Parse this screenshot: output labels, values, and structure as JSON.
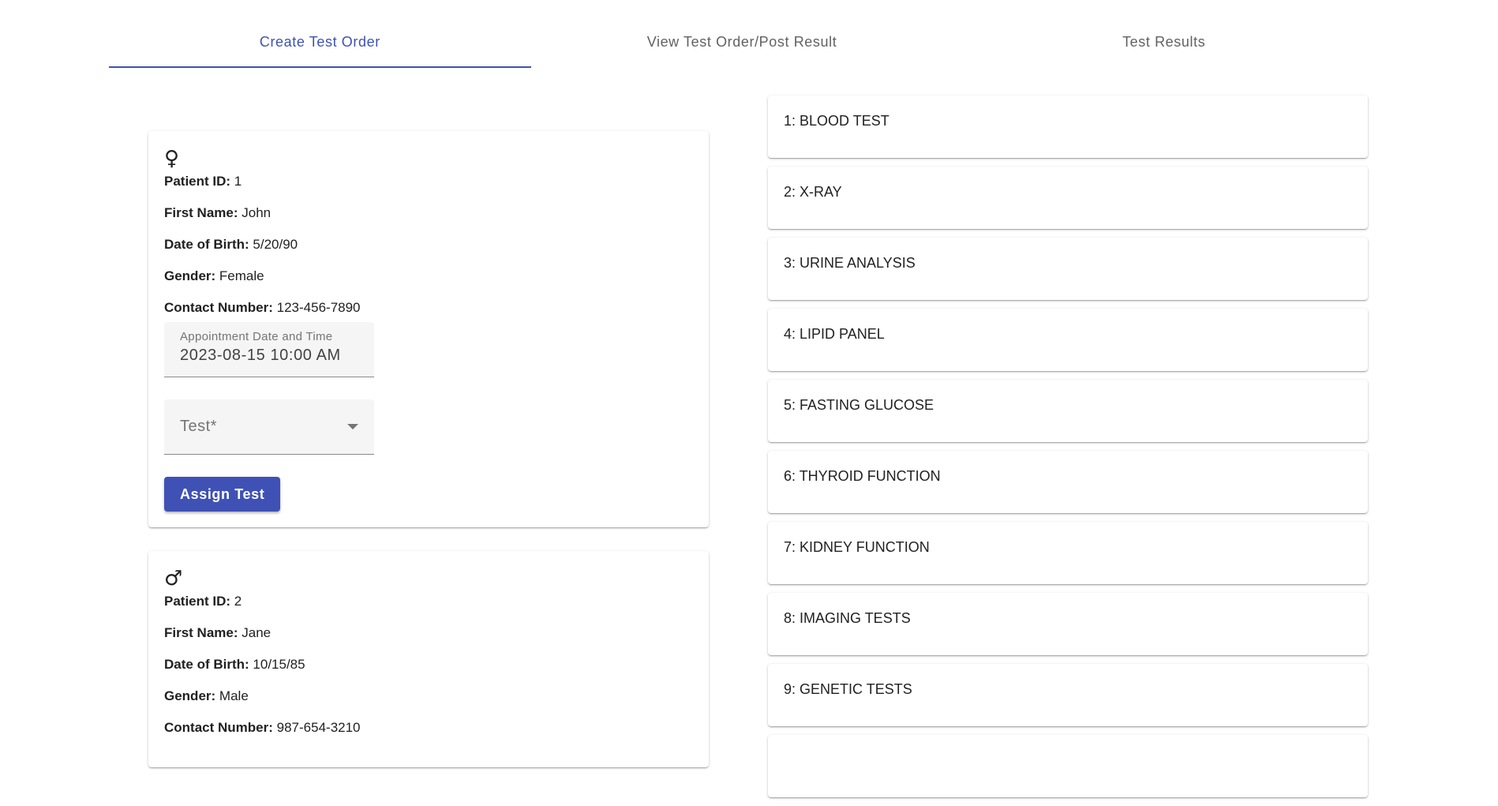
{
  "tabs": [
    {
      "label": "Create Test Order",
      "active": true
    },
    {
      "label": "View Test Order/Post Result",
      "active": false
    },
    {
      "label": "Test Results",
      "active": false
    }
  ],
  "colors": {
    "primary": "#3f51b5"
  },
  "patients": [
    {
      "gender_icon": "female-icon",
      "gender_symbol": "♀",
      "patient_id_label": "Patient ID:",
      "patient_id": "1",
      "first_name_label": "First Name:",
      "first_name": "John",
      "dob_label": "Date of Birth:",
      "dob": "5/20/90",
      "gender_label": "Gender:",
      "gender": "Female",
      "contact_label": "Contact Number:",
      "contact": "123-456-7890",
      "appointment_label": "Appointment Date and Time",
      "appointment_value": "2023-08-15 10:00  AM",
      "test_placeholder": "Test*",
      "assign_label": "Assign Test"
    },
    {
      "gender_icon": "male-icon",
      "gender_symbol": "♂",
      "patient_id_label": "Patient ID:",
      "patient_id": "2",
      "first_name_label": "First Name:",
      "first_name": "Jane",
      "dob_label": "Date of Birth:",
      "dob": "10/15/85",
      "gender_label": "Gender:",
      "gender": "Male",
      "contact_label": "Contact Number:",
      "contact": "987-654-3210"
    }
  ],
  "tests": [
    "1: BLOOD TEST",
    "2: X-RAY",
    "3: URINE ANALYSIS",
    "4: LIPID PANEL",
    "5: FASTING GLUCOSE",
    "6: THYROID FUNCTION",
    "7: KIDNEY FUNCTION",
    "8: IMAGING TESTS",
    "9: GENETIC TESTS",
    ""
  ]
}
